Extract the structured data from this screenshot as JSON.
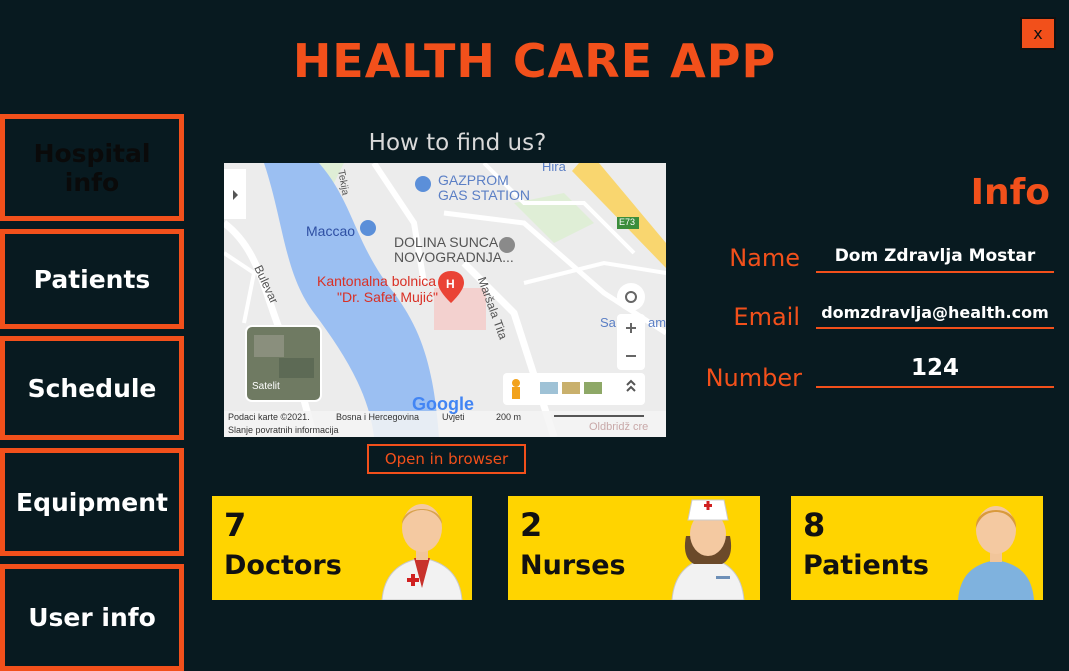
{
  "app": {
    "title": "HEALTH CARE APP",
    "close_label": "x"
  },
  "nav": {
    "items": [
      {
        "label": "Hospital info",
        "active": true
      },
      {
        "label": "Patients"
      },
      {
        "label": "Schedule"
      },
      {
        "label": "Equipment"
      },
      {
        "label": "User info"
      }
    ]
  },
  "map": {
    "heading": "How to find us?",
    "labels": {
      "gazprom_1": "GAZPROM",
      "gazprom_2": "GAS STATION",
      "hira": "Hira",
      "maccao": "Maccao",
      "dolina_1": "DOLINA SUNCA",
      "dolina_2": "NOVOGRADNJA...",
      "hospital_1": "Kantonalna bolnica",
      "hospital_2": "\"Dr. Safet Mujić\"",
      "bulevar": "Bulevar",
      "tekija": "Tekija",
      "marsala": "Maršala Tita",
      "e73": "E73",
      "sahat": "Sa",
      "sahat2": "am",
      "satelit": "Satelit",
      "google": "Google",
      "footer_1": "Podaci karte ©2021.",
      "footer_2": "Bosna i Hercegovina",
      "footer_3": "Uvjeti",
      "scale": "200 m",
      "footer_4": "Slanje povratnih informacija",
      "oldbridge": "Oldbridž cre"
    },
    "open_browser_label": "Open in browser"
  },
  "info": {
    "title": "Info",
    "name_label": "Name",
    "name_value": "Dom Zdravlja Mostar",
    "email_label": "Email",
    "email_value": "domzdravlja@health.com",
    "number_label": "Number",
    "number_value": "124"
  },
  "stats": [
    {
      "count": "7",
      "label": "Doctors",
      "icon": "doctor-icon"
    },
    {
      "count": "2",
      "label": "Nurses",
      "icon": "nurse-icon"
    },
    {
      "count": "8",
      "label": "Patients",
      "icon": "patient-icon"
    }
  ],
  "colors": {
    "accent": "#f2501b",
    "background": "#081a20",
    "card": "#ffd400"
  }
}
